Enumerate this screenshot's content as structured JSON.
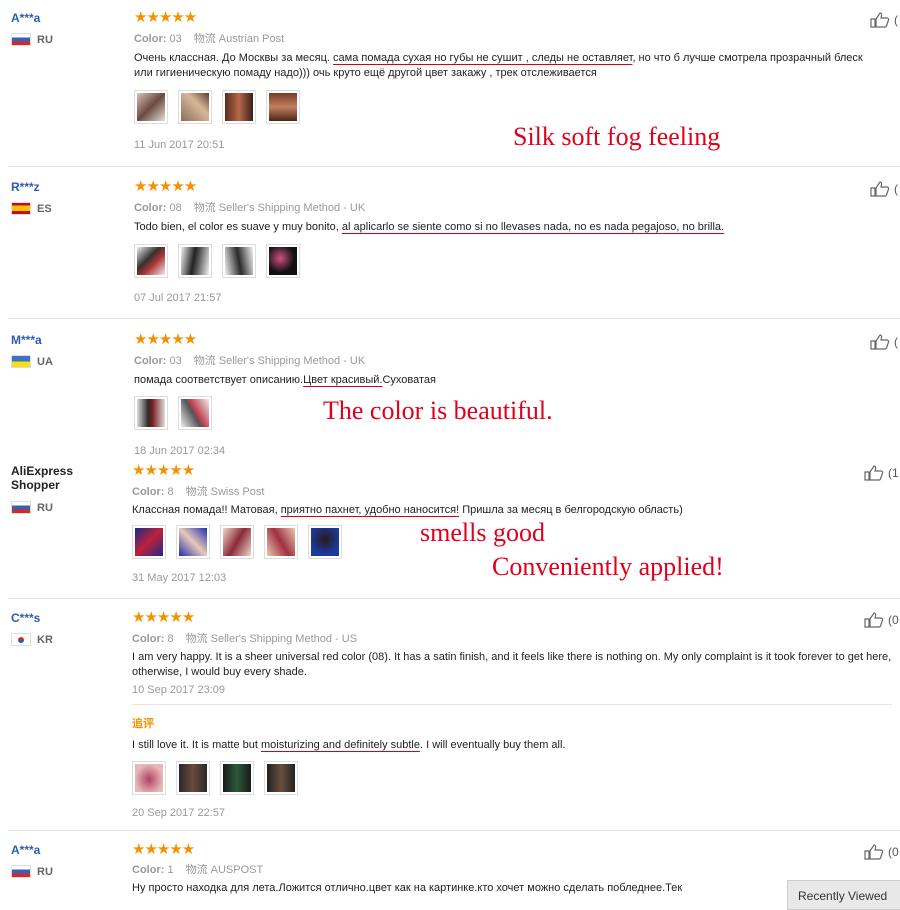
{
  "reviews": [
    {
      "user": "A***a",
      "country": "RU",
      "color": "Color:",
      "color_val": "03",
      "ship_label": "物流",
      "ship": "Austrian Post",
      "text_pre": "Очень классная. До Москвы за месяц. ",
      "text_hl": "сама помада сухая но губы не сушит , следы не оставляет",
      "text_post": ", но что б лучше смотрела прозрачный блеск или гигиеническую помаду надо))) очь круто ещё другой цвет закажу , трек отслеживается",
      "date": "11 Jun 2017 20:51",
      "likes": "("
    },
    {
      "user": "R***z",
      "country": "ES",
      "color": "Color:",
      "color_val": "08",
      "ship_label": "物流",
      "ship": "Seller's Shipping Method - UK",
      "text_pre": "Todo bien, el color es suave y muy bonito, ",
      "text_hl": "al aplicarlo se siente como si no llevases nada, no es nada pegajoso, no brilla.",
      "text_post": "",
      "date": "07 Jul 2017 21:57",
      "likes": "("
    },
    {
      "user": "M***a",
      "country": "UA",
      "color": "Color:",
      "color_val": "03",
      "ship_label": "物流",
      "ship": "Seller's Shipping Method - UK",
      "text_pre": "помада соответствует описанию.",
      "text_hl": "Цвет красивый.",
      "text_post": "Суховатая",
      "date": "18 Jun 2017 02:34",
      "likes": "("
    },
    {
      "user": "AliExpress Shopper",
      "country": "RU",
      "color": "Color:",
      "color_val": "8",
      "ship_label": "物流",
      "ship": "Swiss Post",
      "text_pre": "Классная помада!! Матовая, ",
      "text_hl": "приятно пахнет, удобно наносится!",
      "text_post": " Пришла за месяц в белгородскую область)",
      "date": "31 May 2017 12:03",
      "likes": "(1"
    },
    {
      "user": "C***s",
      "country": "KR",
      "color": "Color:",
      "color_val": "8",
      "ship_label": "物流",
      "ship": "Seller's Shipping Method - US",
      "text_pre": "I am very happy. It is a sheer universal red color (08). It has a satin finish, and it feels like there is nothing on. My only complaint is it took forever to get here, otherwise, I would buy every shade.",
      "text_hl": "",
      "text_post": "",
      "date": "10 Sep 2017 23:09",
      "likes": "(0",
      "append_title": "追评",
      "append_pre": "I still love it. It is matte but ",
      "append_hl": "moisturizing and definitely subtle",
      "append_post": ". I will eventually buy them all.",
      "append_date": "20 Sep 2017 22:57"
    },
    {
      "user": "A***a",
      "country": "RU",
      "color": "Color:",
      "color_val": "1",
      "ship_label": "物流",
      "ship": "AUSPOST",
      "text_pre": "Ну просто находка для лета.Ложится отлично.цвет как на картинке.кто хочет можно сделать побледнее.Тек",
      "text_hl": "",
      "text_post": "",
      "likes": "(0"
    }
  ],
  "stars": "★★★★★",
  "overlays": {
    "silk": "Silk soft fog feeling",
    "beautiful": "The color is beautiful.",
    "smells": "smells good",
    "applied": "Conveniently applied!"
  },
  "recently_viewed": "Recently Viewed",
  "colors": {
    "accent_red": "#e0001b",
    "star": "#f39200",
    "user_blue": "#2a5db0"
  }
}
